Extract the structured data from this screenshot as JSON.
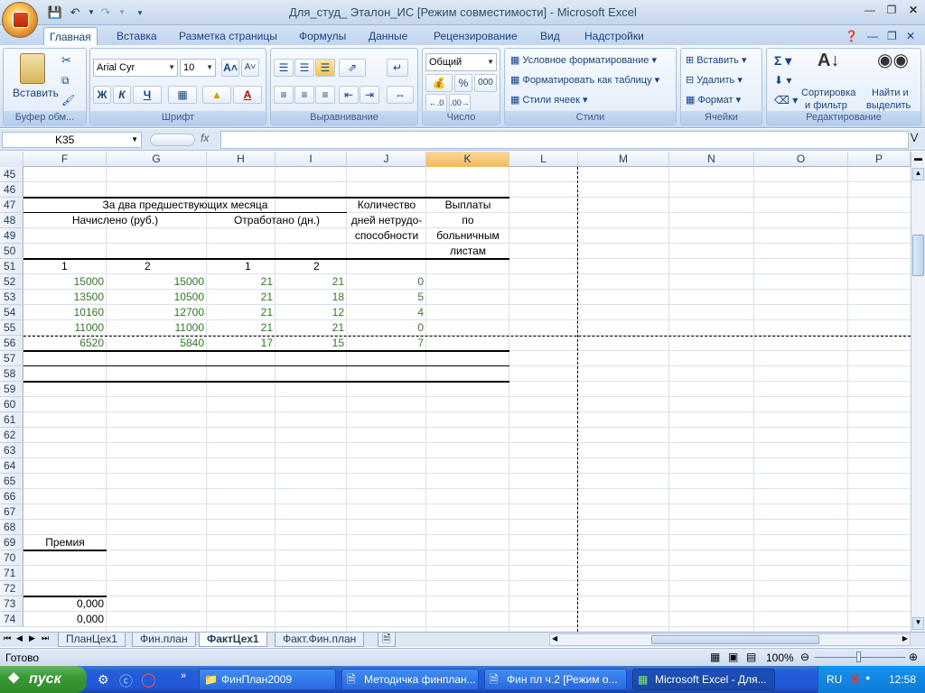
{
  "window": {
    "title": "Для_студ_ Эталон_ИС  [Режим совместимости] - Microsoft Excel"
  },
  "ribbon_tabs": [
    "Главная",
    "Вставка",
    "Разметка страницы",
    "Формулы",
    "Данные",
    "Рецензирование",
    "Вид",
    "Надстройки"
  ],
  "ribbon": {
    "clipboard": {
      "paste": "Вставить",
      "title": "Буфер обм..."
    },
    "font": {
      "name": "Arial Cyr",
      "size": "10",
      "bold": "Ж",
      "italic": "К",
      "underline": "Ч",
      "title": "Шрифт"
    },
    "alignment": {
      "title": "Выравнивание"
    },
    "number": {
      "format": "Общий",
      "percent": "%",
      "thousands": "000",
      "title": "Число"
    },
    "styles": {
      "cond": "Условное форматирование",
      "table": "Форматировать как таблицу",
      "cell": "Стили ячеек",
      "title": "Стили"
    },
    "cells": {
      "insert": "Вставить",
      "delete": "Удалить",
      "format": "Формат",
      "title": "Ячейки"
    },
    "editing": {
      "sort1": "Сортировка",
      "sort2": "и фильтр",
      "find1": "Найти и",
      "find2": "выделить",
      "title": "Редактирование"
    }
  },
  "formula_bar": {
    "name_box": "K35",
    "fx": "fx",
    "value": ""
  },
  "columns": [
    "F",
    "G",
    "H",
    "I",
    "J",
    "K",
    "L",
    "M",
    "N",
    "O",
    "P"
  ],
  "active_column": "K",
  "rows": [
    "45",
    "46",
    "47",
    "48",
    "49",
    "50",
    "51",
    "52",
    "53",
    "54",
    "55",
    "56",
    "57",
    "58",
    "59",
    "60",
    "61",
    "62",
    "63",
    "64",
    "65",
    "66",
    "67",
    "68",
    "69",
    "70",
    "71",
    "72",
    "73",
    "74"
  ],
  "table_header": {
    "two_months": "За два предшествующих месяца",
    "accrued": "Начислено (руб.)",
    "worked": "Отработано (дн.)",
    "qty1": "Количество",
    "qty2": "дней нетрудо-",
    "qty3": "способности",
    "pay1": "Выплаты",
    "pay2": "по",
    "pay3": "больничным",
    "pay4": "листам",
    "sub": [
      "1",
      "2",
      "1",
      "2"
    ]
  },
  "table_rows": [
    [
      "15000",
      "15000",
      "21",
      "21",
      "0"
    ],
    [
      "13500",
      "10500",
      "21",
      "18",
      "5"
    ],
    [
      "10160",
      "12700",
      "21",
      "12",
      "4"
    ],
    [
      "11000",
      "11000",
      "21",
      "21",
      "0"
    ],
    [
      "6520",
      "5840",
      "17",
      "15",
      "7"
    ]
  ],
  "bonus": {
    "label": "Премия",
    "v1": "0,000",
    "v2": "0,000"
  },
  "sheets": [
    "ПланЦех1",
    "Фин.план",
    "ФактЦех1",
    "Факт.Фин.план"
  ],
  "active_sheet": "ФактЦех1",
  "status": {
    "ready": "Готово",
    "zoom": "100%"
  },
  "taskbar": {
    "start": "пуск",
    "items": [
      "ФинПлан2009",
      "Методичка финплан...",
      "Фин пл ч.2 [Режим о...",
      "Microsoft Excel - Для..."
    ],
    "lang": "RU",
    "clock": "12:58"
  }
}
